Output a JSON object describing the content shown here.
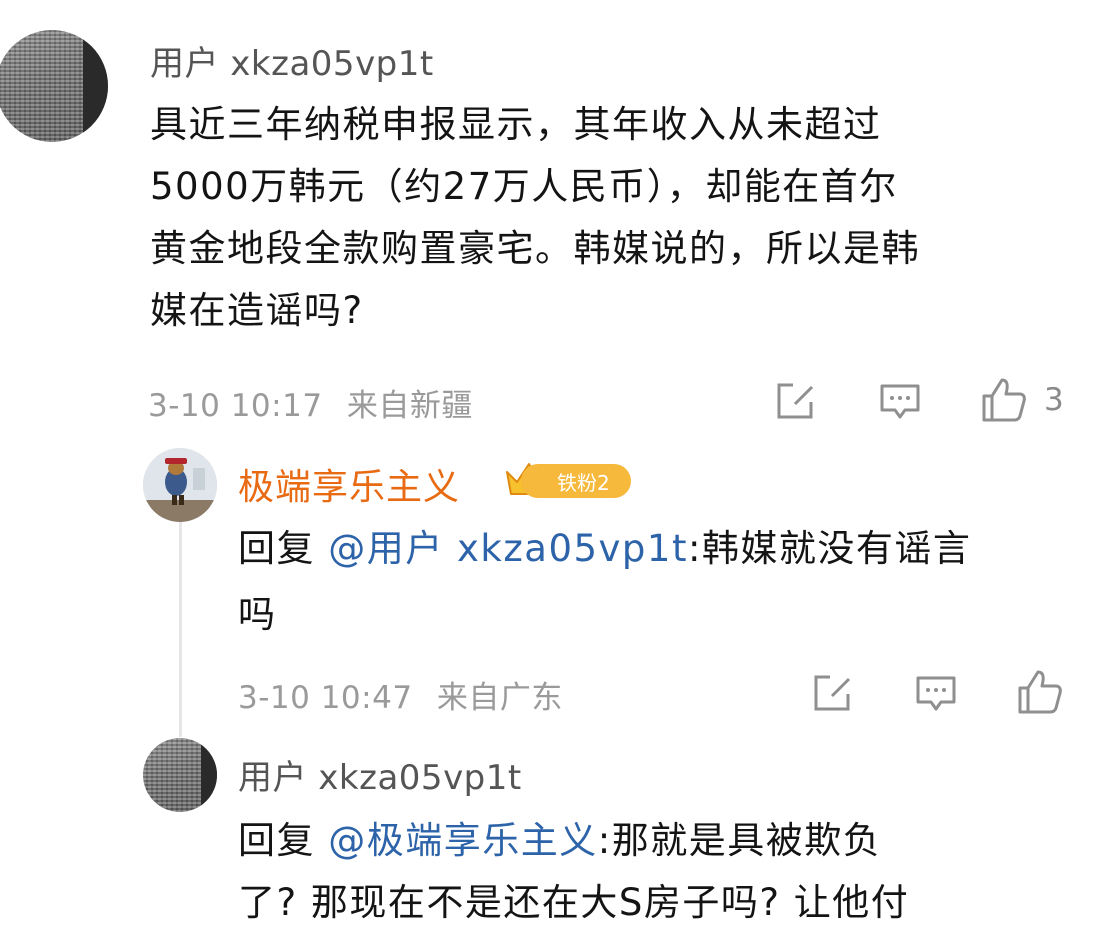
{
  "comment": {
    "username": "用户 xkza05vp1t",
    "text_lines": [
      "具近三年纳税申报显示，其年收入从未超过",
      "5000万韩元（约27万人民币），却能在首尔",
      "黄金地段全款购置豪宅。韩媒说的，所以是韩",
      "媒在造谣吗?"
    ],
    "timestamp": "3-10 10:17",
    "location": "来自新疆",
    "like_count": "3"
  },
  "reply1": {
    "username": "极端享乐主义",
    "badge": "铁粉2",
    "reply_prefix": "回复 ",
    "mention": "@用户 xkza05vp1t",
    "text_line1": ":韩媒就没有谣言",
    "text_line2": "吗",
    "timestamp": "3-10 10:47",
    "location": "来自广东"
  },
  "reply2": {
    "username": "用户 xkza05vp1t",
    "reply_prefix": "回复 ",
    "mention": "@极端享乐主义",
    "text_line1": ":那就是具被欺负",
    "text_line2": "了? 那现在不是还在大S房子吗? 让他付"
  },
  "icons": {
    "share": "share-edit-icon",
    "comment": "comment-bubble-icon",
    "like": "thumbs-up-icon",
    "fan_crown": "crown-fan-icon"
  },
  "colors": {
    "username_highlight": "#e86a12",
    "mention": "#2d63a8",
    "badge": "#f6b93b",
    "meta": "#9a9a9a"
  }
}
